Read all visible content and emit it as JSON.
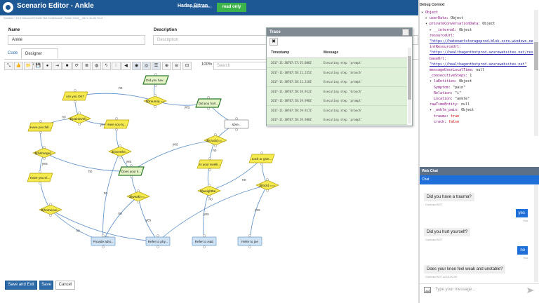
{
  "header": {
    "app_title": "Scenario Editor - Ankle",
    "user_name": "Hadas Bitran",
    "user_role": "( System Admin )",
    "status_badge": "read only"
  },
  "breadcrumb": "Solution \\ HI-4 Microsoft Health Bot Dashboard \\ 'Ankle 2019__2017-11-30 T0-4",
  "form": {
    "name_label": "Name",
    "name_value": "Ankle",
    "description_label": "Description",
    "description_placeholder": "Description"
  },
  "tabs": [
    "Code",
    "Designer (beta)"
  ],
  "toolbar": {
    "icons": [
      "expand-icon",
      "thumbs-up-icon",
      "folder-icon",
      "save-icon",
      "info-icon",
      "signin-icon",
      "camera-icon",
      "refresh-icon",
      "database-icon",
      "globe-icon",
      "bolt-icon",
      "chat-bubble-icon",
      "arrow-left-icon",
      "target-icon",
      "eye-icon",
      "list-icon",
      "zoom-in-icon",
      "zoom-out-icon",
      "fit-icon"
    ],
    "glyphs": [
      "⤡",
      "👍",
      "📁",
      "💾",
      "●",
      "⇥",
      "■",
      "⟳",
      "≣",
      "◍",
      "ϟ",
      "◌",
      "◀",
      "◉",
      "◎",
      "☰",
      "⊕",
      "⊖",
      "⊡"
    ],
    "zoom": "100%",
    "search_placeholder": "Search"
  },
  "flow": {
    "nodes": [
      {
        "id": "n1",
        "label": "Did you hav...",
        "shape": "para",
        "style": "green"
      },
      {
        "id": "n2",
        "label": "Are you OK?",
        "shape": "para",
        "style": "yellow"
      },
      {
        "id": "n3",
        "label": "${trauma} ==",
        "shape": "diamond",
        "style": "yellow"
      },
      {
        "id": "n4",
        "label": "Did you hurt...",
        "shape": "para",
        "style": "green"
      },
      {
        "id": "n5",
        "label": "${painlevel}...",
        "shape": "diamond",
        "style": "yellow"
      },
      {
        "id": "n6",
        "label": "Have you full...",
        "shape": "para",
        "style": "yellow"
      },
      {
        "id": "n7",
        "label": "Have you ty...",
        "shape": "para",
        "style": "yellow"
      },
      {
        "id": "n8",
        "label": "&{se...",
        "shape": "rect",
        "style": "white"
      },
      {
        "id": "n9",
        "label": "${fullrange}...",
        "shape": "diamond",
        "style": "yellow"
      },
      {
        "id": "n10",
        "label": "${overthe...",
        "shape": "diamond",
        "style": "yellow"
      },
      {
        "id": "n11",
        "label": "${crack}==...",
        "shape": "diamond",
        "style": "yellow"
      },
      {
        "id": "n12",
        "label": "Does your k...",
        "shape": "para",
        "style": "green"
      },
      {
        "id": "n13",
        "label": "Is your swelli...",
        "shape": "para",
        "style": "yellow"
      },
      {
        "id": "n14",
        "label": "Lock or give...",
        "shape": "para",
        "style": "yellow"
      },
      {
        "id": "n15",
        "label": "Have you tri...",
        "shape": "para",
        "style": "yellow"
      },
      {
        "id": "n16",
        "label": "${weightbe...",
        "shape": "diamond",
        "style": "yellow"
      },
      {
        "id": "n17",
        "label": "${lock} ===",
        "shape": "diamond",
        "style": "yellow"
      },
      {
        "id": "n18",
        "label": "${weak}==...",
        "shape": "diamond",
        "style": "yellow"
      },
      {
        "id": "n19",
        "label": "${homeove...",
        "shape": "diamond",
        "style": "yellow"
      },
      {
        "id": "n20",
        "label": "Provide advi...",
        "shape": "rect",
        "style": "blue"
      },
      {
        "id": "n21",
        "label": "Refer to phy...",
        "shape": "rect",
        "style": "blue"
      },
      {
        "id": "n22",
        "label": "Refer to A&E",
        "shape": "rect",
        "style": "blue"
      },
      {
        "id": "n23",
        "label": "Refer to joe",
        "shape": "rect",
        "style": "blue"
      }
    ],
    "edges": [
      {
        "from": "n1",
        "to": "n3"
      },
      {
        "from": "n3",
        "to": "n2",
        "label": "no"
      },
      {
        "from": "n3",
        "to": "n4",
        "label": "yes"
      },
      {
        "from": "n2",
        "to": "n5"
      },
      {
        "from": "n5",
        "to": "n6",
        "label": "no"
      },
      {
        "from": "n5",
        "to": "n7",
        "label": "yes"
      },
      {
        "from": "n4",
        "to": "n8"
      },
      {
        "from": "n6",
        "to": "n9"
      },
      {
        "from": "n7",
        "to": "n10"
      },
      {
        "from": "n9",
        "to": "n15",
        "label": "yes"
      },
      {
        "from": "n9",
        "to": "n12",
        "label": "no"
      },
      {
        "from": "n10",
        "to": "n12",
        "label": "yes"
      },
      {
        "from": "n10",
        "to": "n20",
        "label": "no"
      },
      {
        "from": "n8",
        "to": "n11"
      },
      {
        "from": "n11",
        "to": "n12",
        "label": "yes"
      },
      {
        "from": "n11",
        "to": "n13",
        "label": "no"
      },
      {
        "from": "n12",
        "to": "n18"
      },
      {
        "from": "n13",
        "to": "n16"
      },
      {
        "from": "n14",
        "to": "n17"
      },
      {
        "from": "n15",
        "to": "n19"
      },
      {
        "from": "n19",
        "to": "n21",
        "label": "yes"
      },
      {
        "from": "n19",
        "to": "n20",
        "label": "no"
      },
      {
        "from": "n18",
        "to": "n21",
        "label": "yes"
      },
      {
        "from": "n18",
        "to": "n20",
        "label": "no"
      },
      {
        "from": "n16",
        "to": "n22",
        "label": "yes"
      },
      {
        "from": "n16",
        "to": "n14",
        "label": "no"
      },
      {
        "from": "n17",
        "to": "n23",
        "label": "yes"
      },
      {
        "from": "n17",
        "to": "n21",
        "label": "no"
      }
    ]
  },
  "trace": {
    "title": "Trace",
    "close_glyph": "✖",
    "columns": [
      "Timestamp",
      "Message"
    ],
    "rows": [
      {
        "time": "2017-11-30T07:57:55.008Z",
        "message": "Executing step 'prompt'"
      },
      {
        "time": "2017-11-30T07:58:11.255Z",
        "message": "Executing step 'branch'"
      },
      {
        "time": "2017-11-30T07:58:11.318Z",
        "message": "Executing step 'prompt'"
      },
      {
        "time": "2017-11-30T07:58:19.912Z",
        "message": "Executing step 'branch'"
      },
      {
        "time": "2017-11-30T07:58:19.998Z",
        "message": "Executing step 'prompt'"
      },
      {
        "time": "2017-11-30T07:58:29.917Z",
        "message": "Executing step 'branch'"
      },
      {
        "time": "2017-11-30T07:58:29.988Z",
        "message": "Executing step 'prompt'"
      }
    ]
  },
  "buttons": {
    "save_exit": "Save and Exit",
    "save": "Save",
    "cancel": "Cancel"
  },
  "debug": {
    "title": "Debug Context",
    "lines": [
      {
        "indent": 0,
        "arrow": "▾",
        "key": "Object",
        "val": ""
      },
      {
        "indent": 1,
        "arrow": "▸",
        "key": "userData:",
        "val": "Object"
      },
      {
        "indent": 1,
        "arrow": "▾",
        "key": "privateConversationData:",
        "val": "Object"
      },
      {
        "indent": 2,
        "arrow": "▸",
        "key": "__internal:",
        "val": "Object"
      },
      {
        "indent": 2,
        "arrow": "",
        "key": "resourceUrl:",
        "val": ""
      },
      {
        "indent": 2,
        "arrow": "",
        "key": "",
        "val": "\"https://hatenantstorageprod.blob.core.windows.net/",
        "link": true
      },
      {
        "indent": 2,
        "arrow": "",
        "key": "intResourceUrl:",
        "val": ""
      },
      {
        "indent": 2,
        "arrow": "",
        "key": "",
        "val": "\"https://healthagentbotprod.azurewebsites.net/reso",
        "link": true
      },
      {
        "indent": 2,
        "arrow": "",
        "key": "baseUrl:",
        "val": ""
      },
      {
        "indent": 2,
        "arrow": "",
        "key": "",
        "val": "\"https://healthagentbotprod.azurewebsites.net\"",
        "link": true
      },
      {
        "indent": 2,
        "arrow": "",
        "key": "messageUserLocalTime:",
        "val": "null"
      },
      {
        "indent": 2,
        "arrow": "",
        "key": "_consecutiveSteps:",
        "val": "1"
      },
      {
        "indent": 2,
        "arrow": "▾",
        "key": "luEntities:",
        "val": "Object"
      },
      {
        "indent": 3,
        "arrow": "",
        "key": "Symptom:",
        "val": "\"pain\""
      },
      {
        "indent": 3,
        "arrow": "",
        "key": "Relation:",
        "val": "\"i\""
      },
      {
        "indent": 3,
        "arrow": "",
        "key": "Location:",
        "val": "\"ankle\""
      },
      {
        "indent": 2,
        "arrow": "",
        "key": "rawTimeEntity:",
        "val": "null"
      },
      {
        "indent": 2,
        "arrow": "▾",
        "key": "_ankle_pain:",
        "val": "Object"
      },
      {
        "indent": 3,
        "arrow": "",
        "key": "trauma:",
        "val": "true",
        "red": true
      },
      {
        "indent": 3,
        "arrow": "",
        "key": "crack:",
        "val": "false",
        "red": true
      }
    ]
  },
  "webchat": {
    "title": "Web Chat",
    "chat_label": "Chat",
    "messages": [
      {
        "from": "bot",
        "text": "Did you have a trauma?",
        "meta": "Contoso BOT"
      },
      {
        "from": "user",
        "text": "yes",
        "meta": "You"
      },
      {
        "from": "bot",
        "text": "Did you hurt yourself?",
        "meta": "Contoso BOT"
      },
      {
        "from": "user",
        "text": "no",
        "meta": "You"
      },
      {
        "from": "bot",
        "text": "Does your knee feel weak and unstable?",
        "meta": "Contoso BOT at 10:00:00"
      }
    ],
    "input_placeholder": "Type your message..."
  }
}
